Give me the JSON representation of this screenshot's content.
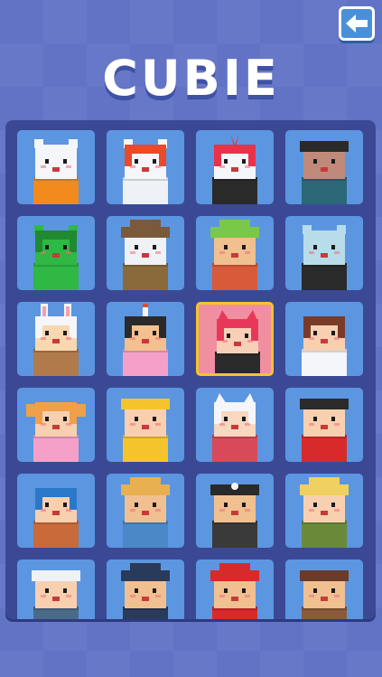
{
  "header": {
    "title": "CUBIE",
    "back_icon": "back-arrow-icon"
  },
  "colors": {
    "background": "#6273c6",
    "panel": "#3b4995",
    "tile": "#5c96e0",
    "tile_selected": "#f08fa0",
    "selected_border": "#f5c42d",
    "back_button": "#4a90d8"
  },
  "grid": {
    "columns": 4,
    "selected_index": 10,
    "characters": [
      {
        "name": "polar-bear-orange-vest",
        "skin": "#f4f6fa",
        "hair": "#f4f6fa",
        "body": "#f28a1e",
        "ears": "round"
      },
      {
        "name": "polar-bear-red-mask",
        "skin": "#f4f6fa",
        "hair": "#e84a2a",
        "body": "#eef2f6",
        "ears": "round"
      },
      {
        "name": "punk-bear-guitar",
        "skin": "#f4f6fa",
        "hair": "#e8324a",
        "body": "#2a2a2a",
        "ears": "mohawk"
      },
      {
        "name": "bear-sunglasses",
        "skin": "#c08a7a",
        "hair": "#2a2a2a",
        "body": "#2a6878",
        "ears": "cap"
      },
      {
        "name": "green-bear",
        "skin": "#2fb844",
        "hair": "#1f8a30",
        "body": "#2fb844",
        "ears": "round"
      },
      {
        "name": "polar-bear-detective",
        "skin": "#eef2f6",
        "hair": "#7a5a3a",
        "body": "#8a6a3a",
        "ears": "hat"
      },
      {
        "name": "tan-bear-green-hat",
        "skin": "#f0c090",
        "hair": "#7ac848",
        "body": "#d85a3a",
        "ears": "hat"
      },
      {
        "name": "blue-bear-suit",
        "skin": "#b8dcea",
        "hair": "#b8dcea",
        "body": "#2a2a2a",
        "ears": "round"
      },
      {
        "name": "bunny-girl",
        "skin": "#f8d8b0",
        "hair": "#f4f6fa",
        "body": "#b07a4a",
        "ears": "bunny"
      },
      {
        "name": "bird-headdress-girl",
        "skin": "#f4c090",
        "hair": "#2a2a2a",
        "body": "#f4a0c8",
        "ears": "feather"
      },
      {
        "name": "cat-ear-pink-hair",
        "skin": "#f8d0b8",
        "hair": "#e8385a",
        "body": "#2a2a2a",
        "ears": "cat"
      },
      {
        "name": "brown-hair-sailor",
        "skin": "#f8d0b0",
        "hair": "#7a3a2a",
        "body": "#f4f6fa",
        "ears": "none"
      },
      {
        "name": "orange-pigtails-girl",
        "skin": "#f8d0b0",
        "hair": "#f0a04a",
        "body": "#f4a0c8",
        "ears": "pigtail"
      },
      {
        "name": "yellow-hood-girl",
        "skin": "#f8d0b0",
        "hair": "#f5c42d",
        "body": "#f5c42d",
        "ears": "hood"
      },
      {
        "name": "white-cat-girl",
        "skin": "#f8d8c0",
        "hair": "#f4f6fa",
        "body": "#d84a5a",
        "ears": "cat"
      },
      {
        "name": "red-chinese-girl",
        "skin": "#f8d0b0",
        "hair": "#2a2a2a",
        "body": "#d82a2a",
        "ears": "cap"
      },
      {
        "name": "blue-hair-boy",
        "skin": "#f8d0b0",
        "hair": "#2a78c8",
        "body": "#c86a3a",
        "ears": "none"
      },
      {
        "name": "farmer-straw-hat",
        "skin": "#f0c090",
        "hair": "#e8b050",
        "body": "#4a88c8",
        "ears": "hat"
      },
      {
        "name": "pirate-captain",
        "skin": "#f0c090",
        "hair": "#2a2a2a",
        "body": "#3a3a3a",
        "ears": "pirate"
      },
      {
        "name": "green-hat-blonde",
        "skin": "#f8d0b0",
        "hair": "#f0d060",
        "body": "#6a8a3a",
        "ears": "hat"
      },
      {
        "name": "helmet-boy",
        "skin": "#f8d0b0",
        "hair": "#eef2f6",
        "body": "#4a6a8a",
        "ears": "cap"
      },
      {
        "name": "police-officer",
        "skin": "#f0c090",
        "hair": "#2a3a5a",
        "body": "#2a3a5a",
        "ears": "hat"
      },
      {
        "name": "firefighter",
        "skin": "#f0c090",
        "hair": "#d82a2a",
        "body": "#d82a2a",
        "ears": "hat"
      },
      {
        "name": "pilot-goggles",
        "skin": "#f0c090",
        "hair": "#6a3a2a",
        "body": "#8a5a3a",
        "ears": "cap"
      }
    ]
  }
}
